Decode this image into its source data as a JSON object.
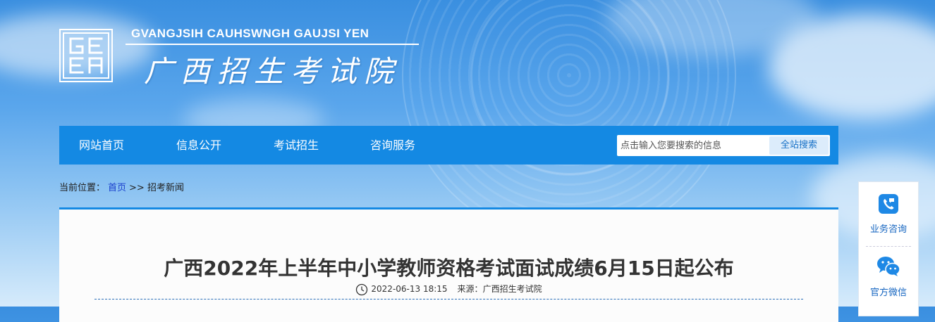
{
  "header": {
    "logo_text": "GEEA",
    "site_name_en": "GVANGJSIH CAUHSWNGH GAUJSI YEN",
    "site_name_cn": "广西招生考试院"
  },
  "nav": {
    "items": [
      "网站首页",
      "信息公开",
      "考试招生",
      "咨询服务"
    ],
    "search_placeholder": "点击输入您要搜索的信息",
    "search_button": "全站搜索"
  },
  "breadcrumb": {
    "prefix": "当前位置：",
    "home": "首页",
    "separator": ">>",
    "current": "招考新闻"
  },
  "article": {
    "title": "广西2022年上半年中小学教师资格考试面试成绩6月15日起公布",
    "date": "2022-06-13 18:15",
    "source_label": "来源：",
    "source": "广西招生考试院"
  },
  "side_panel": {
    "items": [
      {
        "label": "业务咨询",
        "icon": "phone-chat-icon"
      },
      {
        "label": "官方微信",
        "icon": "wechat-icon"
      }
    ]
  },
  "colors": {
    "nav_bg": "#1489e3",
    "accent_link": "#1a3fcc",
    "side_label": "#1565c0"
  }
}
